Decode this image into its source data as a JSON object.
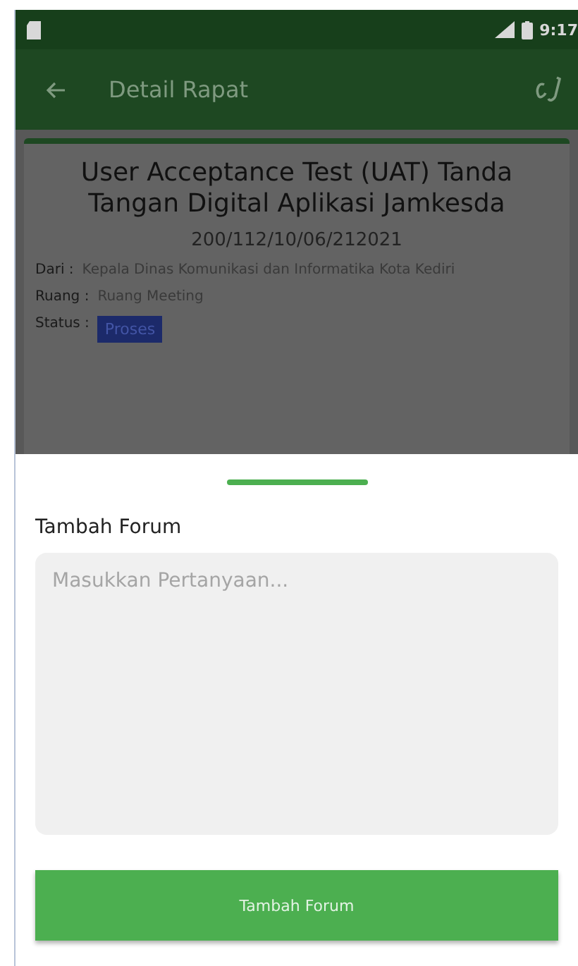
{
  "status_bar": {
    "time": "9:17"
  },
  "app_bar": {
    "title": "Detail Rapat"
  },
  "meeting": {
    "title": "User Acceptance Test (UAT) Tanda Tangan Digital Aplikasi Jamkesda",
    "number": "200/112/10/06/212021",
    "fields": [
      {
        "label": "Dari :",
        "value": "Kepala Dinas Komunikasi dan Informatika Kota Kediri",
        "kind": "text"
      },
      {
        "label": "Ruang :",
        "value": "Ruang Meeting",
        "kind": "text"
      },
      {
        "label": "Status :",
        "value": "Proses",
        "kind": "badge"
      }
    ]
  },
  "sheet": {
    "title": "Tambah Forum",
    "question": {
      "placeholder": "Masukkan Pertanyaan..."
    },
    "submit": "Tambah Forum"
  }
}
